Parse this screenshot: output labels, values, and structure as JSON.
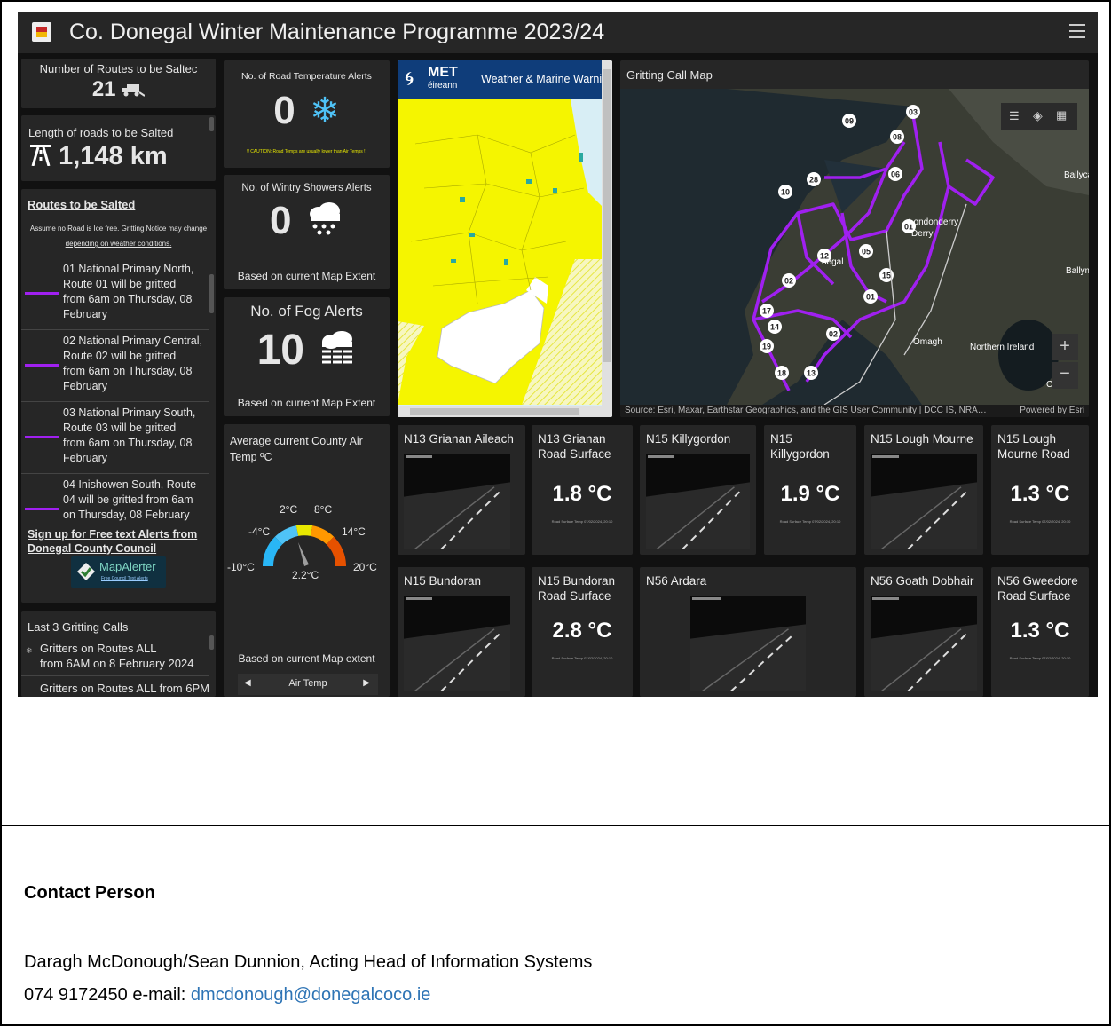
{
  "header": {
    "title": "Co. Donegal Winter Maintenance Programme 2023/24"
  },
  "routes_count": {
    "label": "Number of Routes to be Saltec",
    "value": "21"
  },
  "length": {
    "label": "Length of roads to be Salted",
    "value": "1,148 km"
  },
  "routes": {
    "title": "Routes to be Salted",
    "note1": "Assume no Road is Ice free. Gritting Notice may change",
    "note2": "depending on weather conditions.",
    "items": [
      {
        "l1": "01 National Primary North,",
        "l2": "Route 01 will be gritted",
        "l3": "from 6am on Thursday, 08",
        "l4": "February"
      },
      {
        "l1": "02 National Primary Central,",
        "l2": "Route 02 will be gritted",
        "l3": "from 6am on Thursday, 08",
        "l4": "February"
      },
      {
        "l1": "03 National Primary South,",
        "l2": "Route 03 will be gritted",
        "l3": "from 6am on Thursday, 08",
        "l4": "February"
      },
      {
        "l1": "04 Inishowen South, Route",
        "l2": "04 will be gritted from 6am",
        "l3": "on Thursday, 08 February",
        "l4": ""
      }
    ],
    "signup1": "Sign up for Free text Alerts from",
    "signup2": "Donegal County Council",
    "mapalerter": "MapAlerter",
    "mapalerter_sub": "Free Council Text Alerts"
  },
  "gritting_calls": {
    "title": "Last 3 Gritting Calls",
    "c1a": "Gritters on Routes ALL",
    "c1b": "from 6AM on 8 February 2024",
    "c2": "Gritters on Routes ALL from 6PM"
  },
  "road_temp": {
    "title": "No. of Road Temperature Alerts",
    "value": "0",
    "caution": "!! CAUTION: Road Temps are usually lower than Air Temps !!"
  },
  "wintry": {
    "title": "No. of Wintry Showers Alerts",
    "value": "0",
    "foot": "Based on current Map Extent"
  },
  "fog": {
    "title": "No. of Fog Alerts",
    "value": "10",
    "foot": "Based on current Map Extent"
  },
  "airtemp": {
    "title1": "Average current County Air",
    "title2": "Temp ºC",
    "value": "2.2°C",
    "ticks": {
      "t1": "-10°C",
      "t2": "-4°C",
      "t3": "2°C",
      "t4": "8°C",
      "t5": "14°C",
      "t6": "20°C"
    },
    "foot": "Based on current Map extent",
    "selector": "Air Temp"
  },
  "met": {
    "brand": "MET",
    "brand2": "éireann",
    "title": "Weather & Marine Warni"
  },
  "map": {
    "title": "Gritting Call Map",
    "source": "Source: Esri, Maxar, Earthstar Geographics, and the GIS User Community | DCC IS, NRA…",
    "powered": "Powered by Esri",
    "places": {
      "derry": "Londonderry",
      "derry2": "Derry",
      "omagh": "Omagh",
      "ni": "Northern Ireland",
      "ballyc": "Ballyca",
      "ballym": "Ballyme",
      "donegal": "negal",
      "cr": "Cr"
    },
    "route_labels": [
      "03",
      "08",
      "09",
      "06",
      "10",
      "28",
      "01",
      "12",
      "05",
      "15",
      "02",
      "01",
      "17",
      "14",
      "19",
      "18",
      "13",
      "02"
    ]
  },
  "cams": [
    {
      "title": "N13 Grianan Aileach"
    },
    {
      "title1": "N13 Grianan",
      "title2": "Road Surface",
      "temp": "1.8 °C",
      "note": "Road Surface Temp 07/02/2024, 20:10"
    },
    {
      "title": "N15 Killygordon"
    },
    {
      "title1": "N15",
      "title2": "Killygordon",
      "temp": "1.9 °C",
      "note": "Road Surface Temp 07/02/2024, 20:10"
    },
    {
      "title": "N15 Lough Mourne"
    },
    {
      "title1": "N15 Lough",
      "title2": "Mourne Road",
      "temp": "1.3 °C",
      "note": "Road Surface Temp 07/02/2024, 20:10"
    },
    {
      "title": "N15 Bundoran"
    },
    {
      "title1": "N15 Bundoran",
      "title2": "Road Surface",
      "temp": "2.8 °C",
      "note": "Road Surface Temp 07/02/2024, 20:10"
    },
    {
      "title": "N56 Ardara"
    },
    {
      "title": "N56 Goath Dobhair"
    },
    {
      "title1": "N56 Gweedore",
      "title2": "Road Surface",
      "temp": "1.3 °C",
      "note": "Road Surface Temp 07/02/2024, 20:10"
    }
  ],
  "contact": {
    "heading": "Contact Person",
    "line1": "Daragh McDonough/Sean Dunnion, Acting Head of Information Systems",
    "phone": "074 9172450 e-mail: ",
    "email": "dmcdonough@donegalcoco.ie"
  },
  "colors": {
    "route": "#a020f0",
    "warning_yellow": "#f5f500"
  }
}
